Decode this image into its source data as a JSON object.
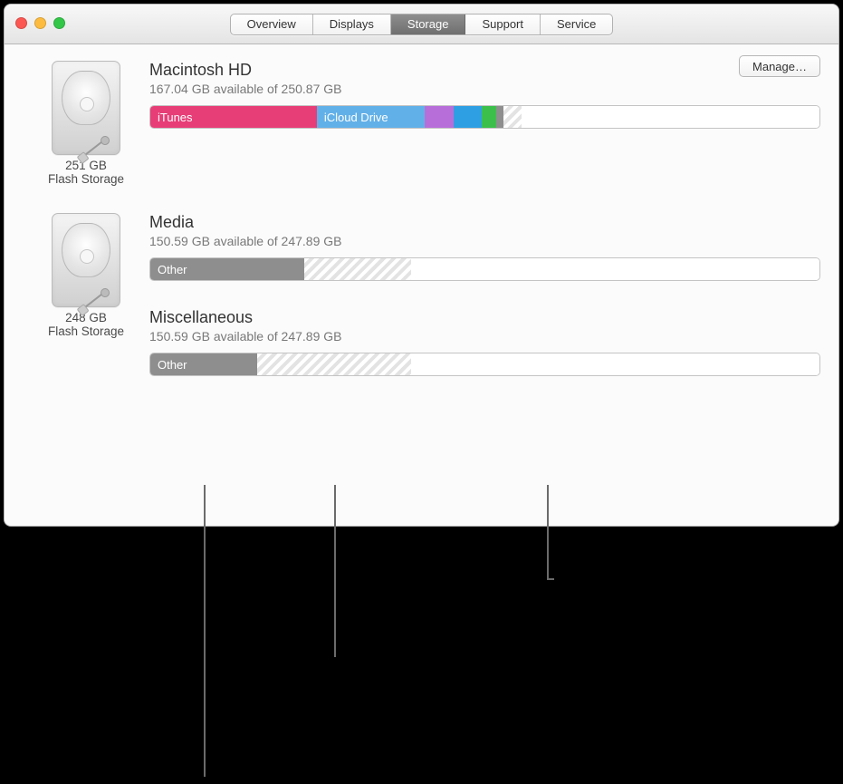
{
  "tabs": [
    "Overview",
    "Displays",
    "Storage",
    "Support",
    "Service"
  ],
  "active_tab_index": 2,
  "manage_label": "Manage…",
  "drives": [
    {
      "size": "251 GB",
      "type": "Flash Storage",
      "volumes": [
        {
          "name": "Macintosh HD",
          "subtitle": "167.04 GB available of 250.87 GB",
          "manage_button": true,
          "segments": [
            {
              "label": "iTunes",
              "pct": 25.0,
              "color": "#e73e77"
            },
            {
              "label": "iCloud Drive",
              "pct": 16.2,
              "color": "#62b0e8"
            },
            {
              "label": "",
              "pct": 4.3,
              "color": "#b86ed9"
            },
            {
              "label": "",
              "pct": 4.3,
              "color": "#2f9fe3"
            },
            {
              "label": "",
              "pct": 2.2,
              "color": "#3cbf4b"
            },
            {
              "label": "",
              "pct": 0.6,
              "color": "#8e8e8e"
            },
            {
              "label": "",
              "pct": 2.6,
              "hatched": true
            },
            {
              "label": "",
              "pct": 44.8,
              "color": "#ffffff"
            }
          ]
        }
      ]
    },
    {
      "size": "248 GB",
      "type": "Flash Storage",
      "volumes": [
        {
          "name": "Media",
          "subtitle": "150.59 GB available of 247.89 GB",
          "manage_button": false,
          "segments": [
            {
              "label": "Other",
              "pct": 23.0,
              "color": "#8e8e8e"
            },
            {
              "label": "",
              "pct": 16.0,
              "hatched": true
            },
            {
              "label": "",
              "pct": 61.0,
              "color": "#ffffff"
            }
          ]
        },
        {
          "name": "Miscellaneous",
          "subtitle": "150.59 GB available of 247.89 GB",
          "manage_button": false,
          "segments": [
            {
              "label": "Other",
              "pct": 16.0,
              "color": "#8e8e8e"
            },
            {
              "label": "",
              "pct": 23.0,
              "hatched": true
            },
            {
              "label": "",
              "pct": 61.0,
              "color": "#ffffff"
            }
          ]
        }
      ]
    }
  ]
}
